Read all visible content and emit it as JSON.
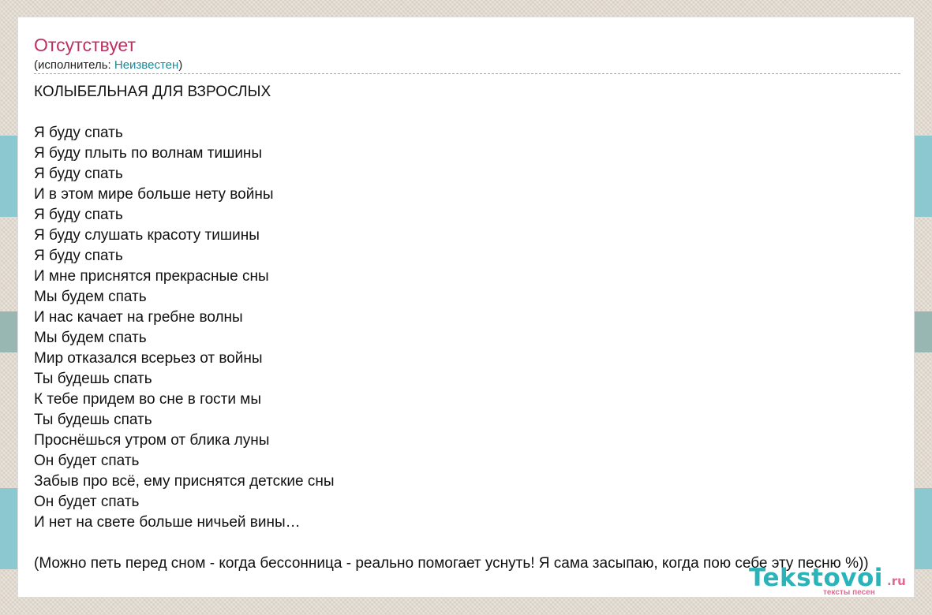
{
  "song": {
    "title": "Отсутствует",
    "artist_prefix": "(исполнитель: ",
    "artist_name": "Неизвестен",
    "artist_suffix": ")"
  },
  "lyrics": "КОЛЫБЕЛЬНАЯ ДЛЯ ВЗРОСЛЫХ\n\nЯ буду спать\nЯ буду плыть по волнам тишины\nЯ буду спать\nИ в этом мире больше нету войны\nЯ буду спать\nЯ буду слушать красоту тишины\nЯ буду спать\nИ мне приснятся прекрасные сны\nМы будем спать\nИ нас качает на гребне волны\nМы будем спать\nМир отказался всерьез от войны\nТы будешь спать\nК тебе придем во сне в гости мы\nТы будешь спать\nПроснёшься утром от блика луны\nОн будет спать\nЗабыв про всё, ему приснятся детские сны\nОн будет спать\nИ нет на свете больше ничьей вины…\n\n(Можно петь перед сном - когда бессонница - реально помогает уснуть! Я сама засыпаю, когда пою себе эту песню %))",
  "logo": {
    "word": "Tekstovoi",
    "tld": ".ru",
    "tagline": "тексты песен"
  },
  "colors": {
    "title": "#c0305e",
    "link": "#1b8a95",
    "logo_primary": "#2ab3b8",
    "logo_accent": "#e06a8e",
    "stripe_teal": "#8cc8cf",
    "background": "#e4ddd2"
  }
}
